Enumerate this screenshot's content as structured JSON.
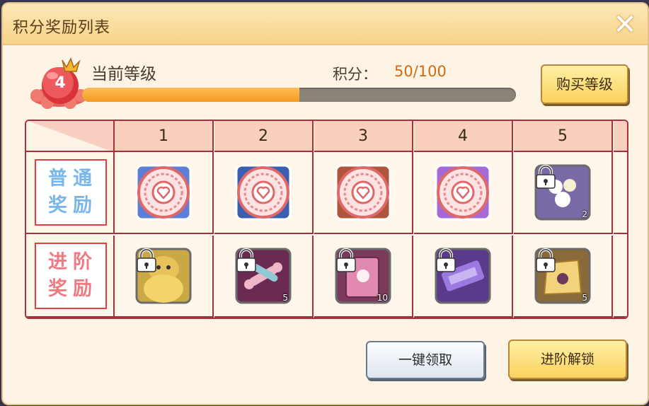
{
  "title": "积分奖励列表",
  "level": {
    "number": "4",
    "label": "当前等级",
    "points_label": "积分：",
    "points_value": "50/100",
    "progress": 0.5
  },
  "buy_button": "购买等级",
  "grid": {
    "columns": [
      "1",
      "2",
      "3",
      "4",
      "5"
    ],
    "rows": [
      {
        "label": "普通奖励",
        "items": [
          {
            "kind": "badge",
            "color": "#5b7fd6",
            "locked": false,
            "qty": ""
          },
          {
            "kind": "badge",
            "color": "#3b5fb0",
            "locked": false,
            "qty": ""
          },
          {
            "kind": "badge",
            "color": "#b0553b",
            "locked": false,
            "qty": ""
          },
          {
            "kind": "badge",
            "color": "#a56ad6",
            "locked": false,
            "qty": ""
          },
          {
            "kind": "flower",
            "color": "#7a6aa8",
            "locked": true,
            "qty": "2"
          }
        ]
      },
      {
        "label": "进阶奖励",
        "items": [
          {
            "kind": "costume",
            "color": "#c9a845",
            "locked": true,
            "qty": ""
          },
          {
            "kind": "bone",
            "color": "#6a2a52",
            "locked": true,
            "qty": "5"
          },
          {
            "kind": "book",
            "color": "#7a3a5a",
            "locked": true,
            "qty": "10"
          },
          {
            "kind": "ticket",
            "color": "#5a3a8a",
            "locked": true,
            "qty": ""
          },
          {
            "kind": "bag",
            "color": "#8a6a3a",
            "locked": true,
            "qty": "5"
          }
        ]
      }
    ]
  },
  "claim_all_button": "一键领取",
  "unlock_advanced_button": "进阶解锁",
  "colors": {
    "accent_orange": "#f39a25",
    "grid_border": "#a3323a",
    "gold_button": "#fbd25e"
  }
}
